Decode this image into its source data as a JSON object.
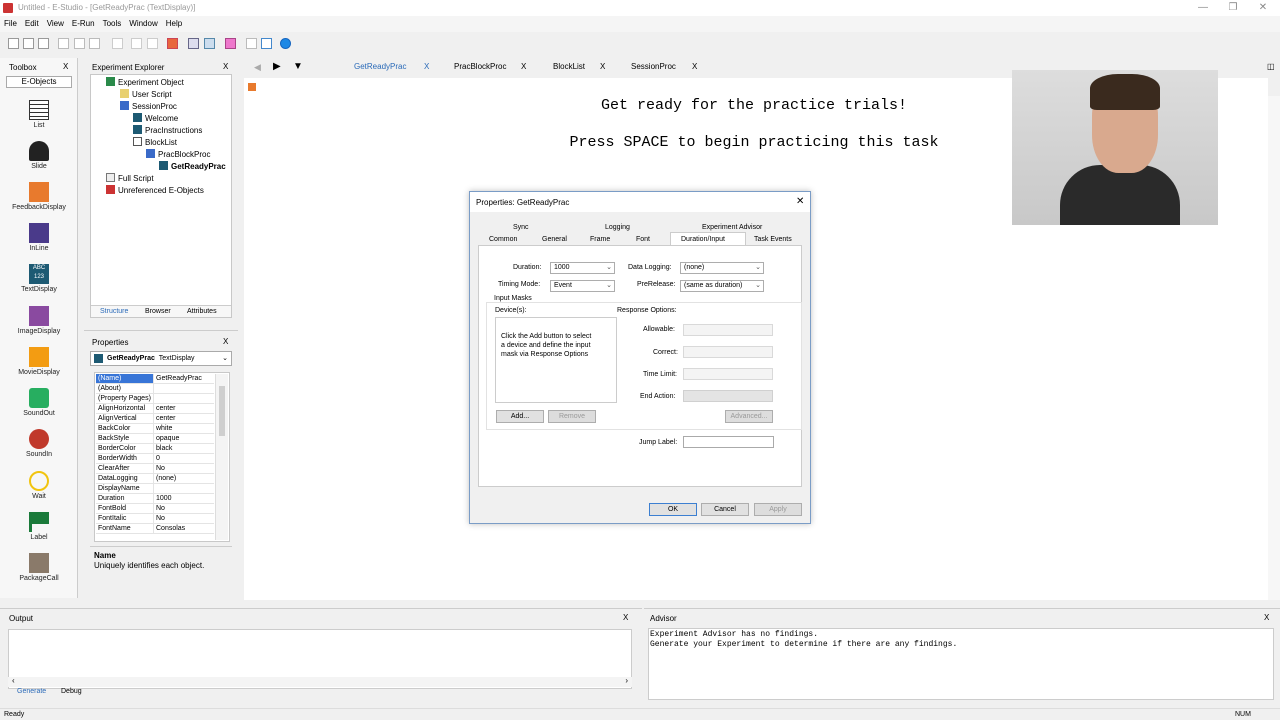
{
  "window": {
    "title": "Untitled - E-Studio - [GetReadyPrac (TextDisplay)]"
  },
  "menu": [
    "File",
    "Edit",
    "View",
    "E-Run",
    "Tools",
    "Window",
    "Help"
  ],
  "toolbox": {
    "title": "Toolbox",
    "tab": "E-Objects",
    "items": [
      "List",
      "Slide",
      "FeedbackDisplay",
      "InLine",
      "TextDisplay",
      "ImageDisplay",
      "MovieDisplay",
      "SoundOut",
      "SoundIn",
      "Wait",
      "Label",
      "PackageCall"
    ]
  },
  "explorer": {
    "title": "Experiment Explorer",
    "tree": [
      "Experiment Object",
      "User Script",
      "SessionProc",
      "Welcome",
      "PracInstructions",
      "BlockList",
      "PracBlockProc",
      "GetReadyPrac",
      "Full Script",
      "Unreferenced E-Objects"
    ],
    "tabs": [
      "Structure",
      "Browser",
      "Attributes"
    ]
  },
  "properties": {
    "title": "Properties",
    "object": "GetReadyPrac",
    "object_type": "TextDisplay",
    "rows": [
      [
        "(Name)",
        "GetReadyPrac"
      ],
      [
        "(About)",
        ""
      ],
      [
        "(Property Pages)",
        ""
      ],
      [
        "AlignHorizontal",
        "center"
      ],
      [
        "AlignVertical",
        "center"
      ],
      [
        "BackColor",
        "white"
      ],
      [
        "BackStyle",
        "opaque"
      ],
      [
        "BorderColor",
        "black"
      ],
      [
        "BorderWidth",
        "0"
      ],
      [
        "ClearAfter",
        "No"
      ],
      [
        "DataLogging",
        "(none)"
      ],
      [
        "DisplayName",
        ""
      ],
      [
        "Duration",
        "1000"
      ],
      [
        "FontBold",
        "No"
      ],
      [
        "FontItalic",
        "No"
      ],
      [
        "FontName",
        "Consolas"
      ]
    ],
    "desc_title": "Name",
    "desc_text": "Uniquely identifies each object."
  },
  "doc_tabs": [
    "GetReadyPrac",
    "PracBlockProc",
    "BlockList",
    "SessionProc"
  ],
  "canvas": {
    "line1": "Get ready for the practice trials!",
    "line2": "Press SPACE to begin practicing this task"
  },
  "dialog": {
    "title": "Properties: GetReadyPrac",
    "tabs_row1": [
      "Sync",
      "Logging",
      "Experiment Advisor"
    ],
    "tabs_row2": [
      "Common",
      "General",
      "Frame",
      "Font",
      "Duration/Input",
      "Task Events"
    ],
    "duration_label": "Duration:",
    "duration_value": "1000",
    "timing_label": "Timing Mode:",
    "timing_value": "Event",
    "datalogging_label": "Data Logging:",
    "datalogging_value": "(none)",
    "prerelease_label": "PreRelease:",
    "prerelease_value": "(same as duration)",
    "input_masks": "Input Masks",
    "devices": "Device(s):",
    "devices_hint": "Click the Add button to select a device and define the input mask via Response Options",
    "response_options": "Response Options:",
    "allowable": "Allowable:",
    "correct": "Correct:",
    "time_limit": "Time Limit:",
    "end_action": "End Action:",
    "add": "Add...",
    "remove": "Remove",
    "advanced": "Advanced...",
    "jump_label": "Jump Label:",
    "ok": "OK",
    "cancel": "Cancel",
    "apply": "Apply"
  },
  "output": {
    "title": "Output",
    "tabs": [
      "Generate",
      "Debug"
    ]
  },
  "advisor": {
    "title": "Advisor",
    "line1": "Experiment Advisor has no findings.",
    "line2": "Generate your Experiment to determine if there are any findings."
  },
  "status": {
    "left": "Ready",
    "right": "NUM"
  }
}
